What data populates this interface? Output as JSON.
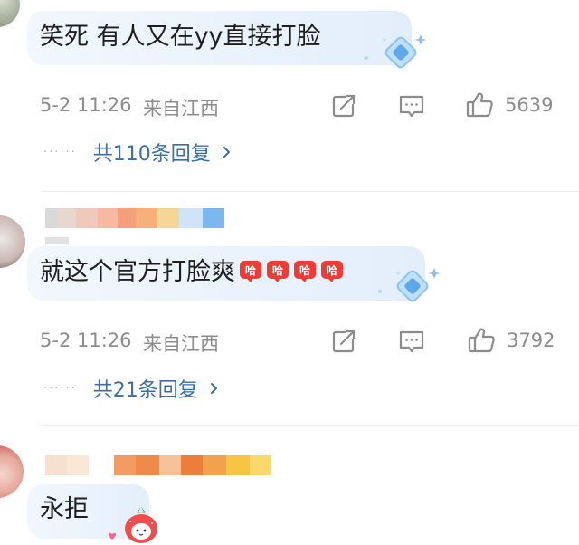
{
  "comments": [
    {
      "text": "笑死 有人又在yy直接打脸",
      "time": "5-2 11:26",
      "location": "来自江西",
      "likes": "5639",
      "replies": "共110条回复",
      "avatar_icon": "avatar-image"
    },
    {
      "text": "就这个官方打脸爽",
      "emoji_icon": "crying-laughing-emoji-icon",
      "emoji_count": 4,
      "time": "5-2 11:26",
      "location": "来自江西",
      "likes": "3792",
      "replies": "共21条回复",
      "username_hidden": true
    },
    {
      "text": "永拒",
      "badge_icon": "strawberry-badge-icon",
      "username_hidden": true
    }
  ],
  "icons": {
    "share": "share-icon",
    "comment": "comment-icon",
    "like": "thumbs-up-icon",
    "chevron": "chevron-right-icon",
    "decor": "blue-diamond-decoration-icon"
  },
  "colors": {
    "link": "#3c6ea3",
    "meta": "#8c8c8c",
    "bubble": "#eaf2fc"
  }
}
